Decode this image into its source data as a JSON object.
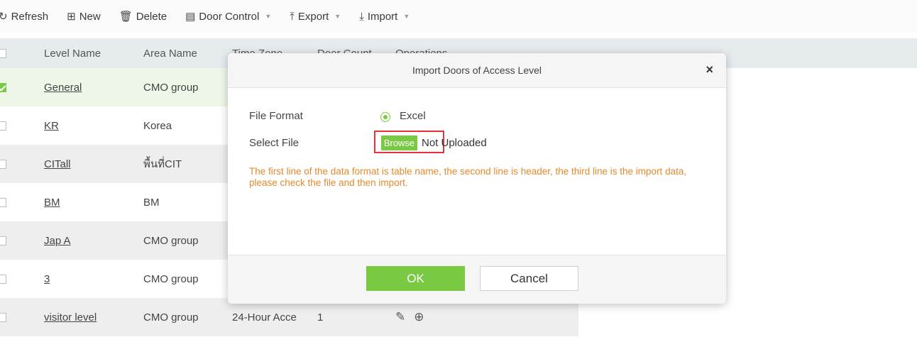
{
  "toolbar": {
    "refresh": "Refresh",
    "new": "New",
    "delete": "Delete",
    "door_control": "Door Control",
    "export": "Export",
    "import": "Import"
  },
  "table": {
    "columns": [
      "Level Name",
      "Area Name",
      "Time Zone",
      "Door Count",
      "Operations"
    ],
    "rows": [
      {
        "level": "General",
        "area": "CMO group",
        "tz": "",
        "count": "",
        "checked": true
      },
      {
        "level": "KR",
        "area": "Korea",
        "tz": "",
        "count": "",
        "checked": false
      },
      {
        "level": "CITall",
        "area": "พื้นที่CIT",
        "tz": "",
        "count": "",
        "checked": false
      },
      {
        "level": "BM",
        "area": "BM",
        "tz": "",
        "count": "",
        "checked": false
      },
      {
        "level": "Jap A",
        "area": "CMO group",
        "tz": "",
        "count": "",
        "checked": false
      },
      {
        "level": "3",
        "area": "CMO group",
        "tz": "",
        "count": "",
        "checked": false
      },
      {
        "level": "visitor level",
        "area": "CMO group",
        "tz": "24-Hour Acce",
        "count": "1",
        "checked": false
      }
    ]
  },
  "dialog": {
    "title": "Import Doors of Access Level",
    "close": "×",
    "file_format_label": "File Format",
    "file_format_value": "Excel",
    "select_file_label": "Select File",
    "browse": "Browse",
    "upload_status": "Not Uploaded",
    "hint": "The first line of the data format is table name, the second line is header, the third line is the import data, please check the file and then import.",
    "ok": "OK",
    "cancel": "Cancel"
  },
  "colors": {
    "accent": "#7ac943",
    "highlight_frame": "#e8303a",
    "hint_text": "#e28a2b"
  }
}
